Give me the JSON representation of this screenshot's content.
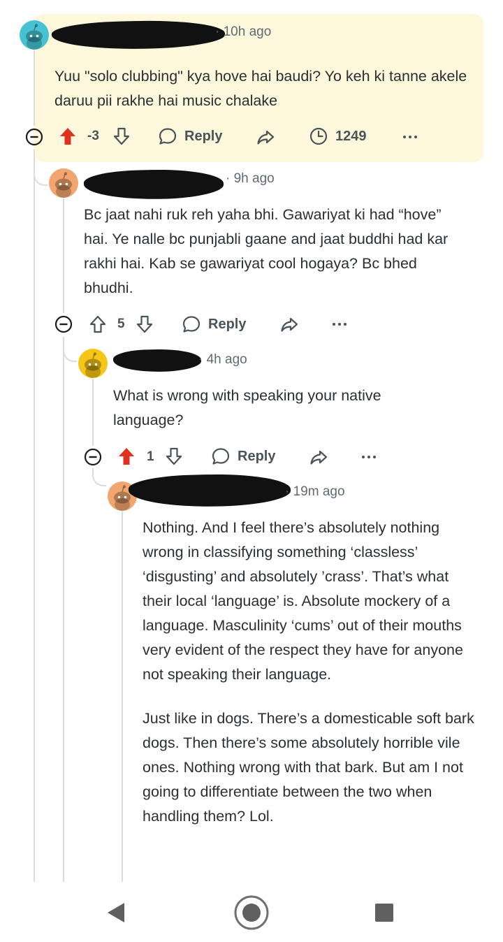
{
  "comments": [
    {
      "timestamp": "10h ago",
      "body": [
        "Yuu \"solo clubbing\" kya hove hai baudi? Yo keh ki tanne akele daruu pii rakhe hai music chalake"
      ],
      "vote_count": "-3",
      "vote_state": "upvoted",
      "reply_label": "Reply",
      "awards_count": "1249",
      "avatar_color": "#46c2d4"
    },
    {
      "timestamp": "9h ago",
      "body": [
        "Bc jaat nahi ruk reh yaha bhi. Gawariyat ki had “hove” hai. Ye nalle bc punjabli gaane and jaat buddhi had kar rakhi hai. Kab se gawariyat cool hogaya? Bc bhed bhudhi."
      ],
      "vote_count": "5",
      "vote_state": "none",
      "reply_label": "Reply",
      "avatar_color": "#f2a56e"
    },
    {
      "timestamp": "4h ago",
      "body": [
        "What is wrong with speaking your native language?"
      ],
      "vote_count": "1",
      "vote_state": "upvoted",
      "reply_label": "Reply",
      "avatar_color": "#f5c518"
    },
    {
      "timestamp": "19m ago",
      "body": [
        "Nothing. And I feel there’s absolutely nothing wrong in classifying something ‘classless’ ‘disgusting’ and absolutely ’crass’. That’s what their local ‘language’ is. Absolute mockery of a language. Masculinity ‘cums’ out of their mouths very evident of the respect they have for anyone not speaking their language.",
        "Just like in dogs. There’s a domesticable soft bark dogs. Then there’s some absolutely horrible vile ones. Nothing wrong with that bark. But am I not going to differentiate between the two when handling them? Lol."
      ],
      "avatar_color": "#f2a56e"
    }
  ],
  "colors": {
    "upvote_active": "#e0301e",
    "highlight_bg": "#fdf7dc",
    "thread_line": "#dcdcdc"
  },
  "icons": {
    "collapse": "minus-circle-icon",
    "upvote": "arrow-up-icon",
    "downvote": "arrow-down-icon",
    "reply": "speech-bubble-icon",
    "share": "share-arrow-icon",
    "awards": "clock-icon",
    "more": "ellipsis-icon",
    "nav_back": "triangle-back-icon",
    "nav_home": "circle-home-icon",
    "nav_recents": "square-recents-icon"
  }
}
